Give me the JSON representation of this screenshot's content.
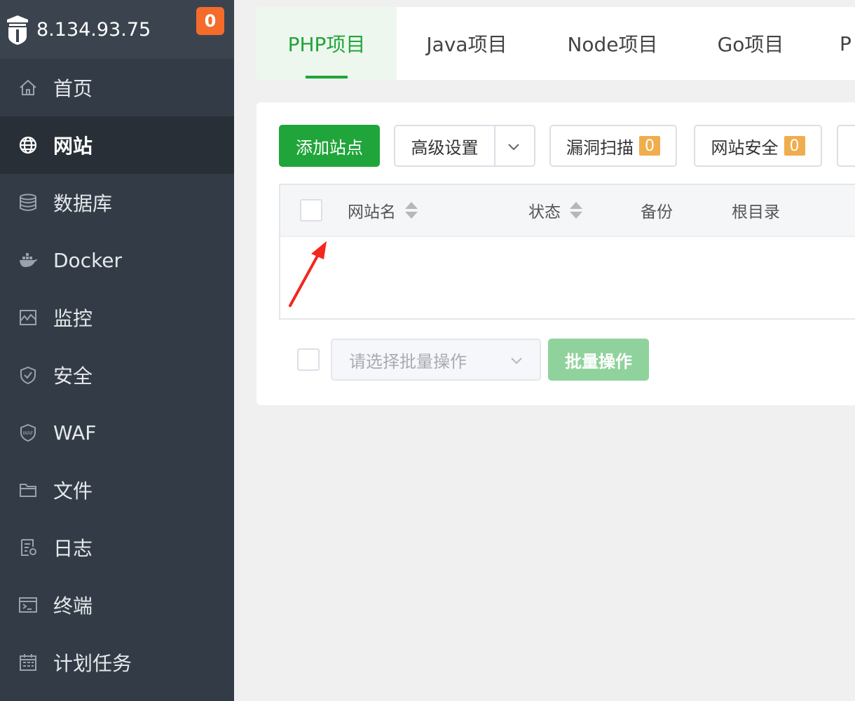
{
  "sidebar": {
    "ip": "8.134.93.75",
    "notification_count": "0",
    "items": [
      {
        "label": "首页",
        "icon": "home-icon",
        "active": false
      },
      {
        "label": "网站",
        "icon": "globe-icon",
        "active": true
      },
      {
        "label": "数据库",
        "icon": "database-icon",
        "active": false
      },
      {
        "label": "Docker",
        "icon": "docker-icon",
        "active": false
      },
      {
        "label": "监控",
        "icon": "monitor-icon",
        "active": false
      },
      {
        "label": "安全",
        "icon": "shield-icon",
        "active": false
      },
      {
        "label": "WAF",
        "icon": "waf-shield-icon",
        "active": false
      },
      {
        "label": "文件",
        "icon": "folder-icon",
        "active": false
      },
      {
        "label": "日志",
        "icon": "log-icon",
        "active": false
      },
      {
        "label": "终端",
        "icon": "terminal-icon",
        "active": false
      },
      {
        "label": "计划任务",
        "icon": "calendar-icon",
        "active": false
      }
    ]
  },
  "tabs": [
    {
      "label": "PHP项目",
      "active": true
    },
    {
      "label": "Java项目",
      "active": false
    },
    {
      "label": "Node项目",
      "active": false
    },
    {
      "label": "Go项目",
      "active": false
    },
    {
      "label": "P",
      "active": false
    }
  ],
  "toolbar": {
    "add_site": "添加站点",
    "advanced_settings": "高级设置",
    "vuln_scan": "漏洞扫描",
    "vuln_scan_count": "0",
    "site_security": "网站安全",
    "site_security_count": "0"
  },
  "table": {
    "columns": [
      "网站名",
      "状态",
      "备份",
      "根目录"
    ]
  },
  "batch": {
    "select_placeholder": "请选择批量操作",
    "button": "批量操作"
  },
  "colors": {
    "sidebar_bg": "#333c46",
    "sidebar_active": "#282f37",
    "accent_green": "#20a53a",
    "badge_orange": "#f46b2b",
    "count_badge": "#f0ad4e",
    "annotation_arrow": "#f3271c"
  }
}
